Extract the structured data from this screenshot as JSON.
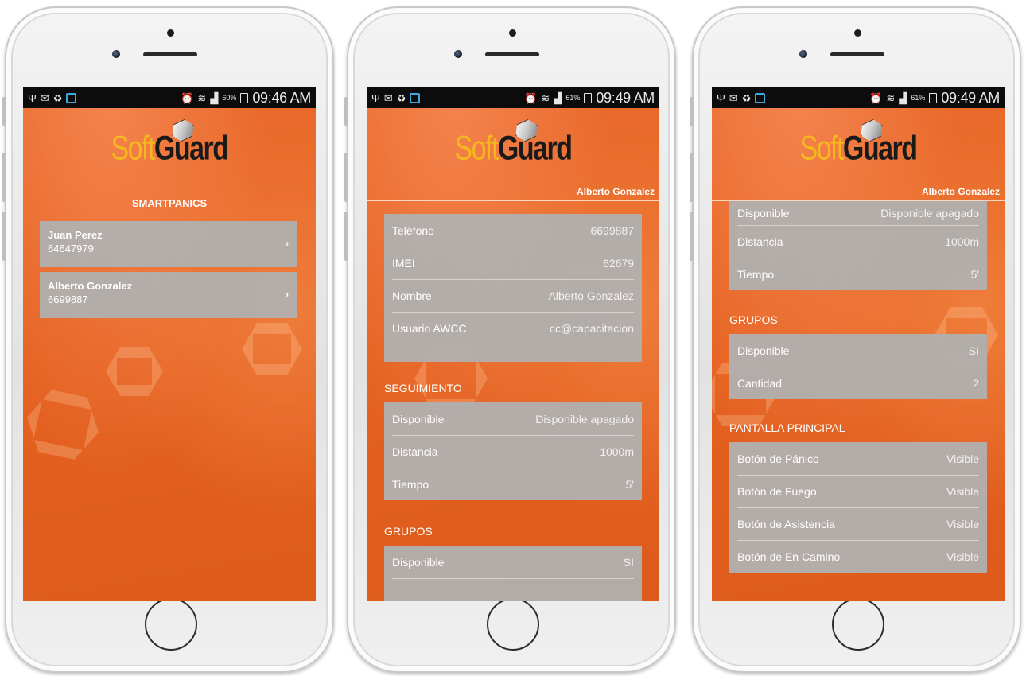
{
  "phones": [
    {
      "status": {
        "battery_pct": "60%",
        "time": "09:46 AM"
      },
      "logo": {
        "soft": "Soft",
        "guard": "Guard"
      },
      "title": "SMARTPANICS",
      "items": [
        {
          "name": "Juan Perez",
          "phone": "64647979"
        },
        {
          "name": "Alberto Gonzalez",
          "phone": "6699887"
        }
      ]
    },
    {
      "status": {
        "battery_pct": "61%",
        "time": "09:49 AM"
      },
      "logo": {
        "soft": "Soft",
        "guard": "Guard"
      },
      "header_name": "Alberto Gonzalez",
      "info_rows": [
        {
          "label": "Teléfono",
          "value": "6699887"
        },
        {
          "label": "IMEI",
          "value": "62679"
        },
        {
          "label": "Nombre",
          "value": "Alberto Gonzalez"
        },
        {
          "label": "Usuario AWCC",
          "value": "cc@capacitacion"
        }
      ],
      "seguimiento": {
        "title": "SEGUIMIENTO",
        "rows": [
          {
            "label": "Disponible",
            "value": "Disponible apagado"
          },
          {
            "label": "Distancia",
            "value": "1000m"
          },
          {
            "label": "Tiempo",
            "value": "5'"
          }
        ]
      },
      "grupos": {
        "title": "GRUPOS",
        "rows": [
          {
            "label": "Disponible",
            "value": "SI"
          }
        ]
      }
    },
    {
      "status": {
        "battery_pct": "61%",
        "time": "09:49 AM"
      },
      "logo": {
        "soft": "Soft",
        "guard": "Guard"
      },
      "header_name": "Alberto Gonzalez",
      "seguimiento_rows": [
        {
          "label": "Disponible",
          "value": "Disponible apagado"
        },
        {
          "label": "Distancia",
          "value": "1000m"
        },
        {
          "label": "Tiempo",
          "value": "5'"
        }
      ],
      "grupos": {
        "title": "GRUPOS",
        "rows": [
          {
            "label": "Disponible",
            "value": "SI"
          },
          {
            "label": "Cantidad",
            "value": "2"
          }
        ]
      },
      "pantalla": {
        "title": "PANTALLA PRINCIPAL",
        "rows": [
          {
            "label": "Botón de Pánico",
            "value": "Visible"
          },
          {
            "label": "Botón de Fuego",
            "value": "Visible"
          },
          {
            "label": "Botón de Asistencia",
            "value": "Visible"
          },
          {
            "label": "Botón de En Camino",
            "value": "Visible"
          }
        ]
      }
    }
  ],
  "icons": [
    "usb-icon",
    "gmail-icon",
    "recycle-icon",
    "app-blue-icon",
    "alarm-icon",
    "wifi-icon",
    "signal-icon",
    "battery-icon",
    "chevron-right-icon"
  ],
  "colors": {
    "brand_orange": "#e5621f",
    "logo_yellow": "#f4b81e",
    "card_gray": "#b0b0b0"
  }
}
